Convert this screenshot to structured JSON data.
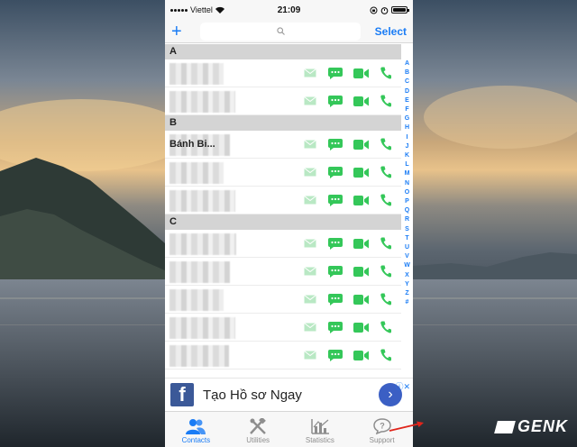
{
  "status_bar": {
    "carrier": "Viettel",
    "time": "21:09"
  },
  "nav": {
    "add_label": "+",
    "search_placeholder": "",
    "select_label": "Select"
  },
  "sections": [
    {
      "letter": "A",
      "rows": [
        {
          "name": ""
        },
        {
          "name": ""
        }
      ]
    },
    {
      "letter": "B",
      "rows": [
        {
          "name": "Bánh Bi..."
        },
        {
          "name": ""
        },
        {
          "name": ""
        }
      ]
    },
    {
      "letter": "C",
      "rows": [
        {
          "name": ""
        },
        {
          "name": ""
        },
        {
          "name": ""
        },
        {
          "name": ""
        },
        {
          "name": ""
        }
      ]
    }
  ],
  "index_letters": [
    "A",
    "B",
    "C",
    "D",
    "E",
    "F",
    "G",
    "H",
    "I",
    "J",
    "K",
    "L",
    "M",
    "N",
    "O",
    "P",
    "Q",
    "R",
    "S",
    "T",
    "U",
    "V",
    "W",
    "X",
    "Y",
    "Z",
    "#"
  ],
  "ad": {
    "text": "Tạo Hồ sơ Ngay",
    "fb_letter": "f",
    "go_icon": "›",
    "close_label": "ⓘ✕"
  },
  "tabs": [
    {
      "label": "Contacts",
      "icon": "contacts-icon",
      "active": true
    },
    {
      "label": "Utilities",
      "icon": "tools-icon",
      "active": false
    },
    {
      "label": "Statistics",
      "icon": "statistics-icon",
      "active": false
    },
    {
      "label": "Support",
      "icon": "support-icon",
      "active": false
    }
  ],
  "watermark": "GENK",
  "colors": {
    "accent": "#1a7cf5",
    "action_green": "#34c759",
    "mail_faded": "#b9e8c4",
    "facebook": "#3b5998",
    "annotation_arrow": "#e0251b"
  }
}
